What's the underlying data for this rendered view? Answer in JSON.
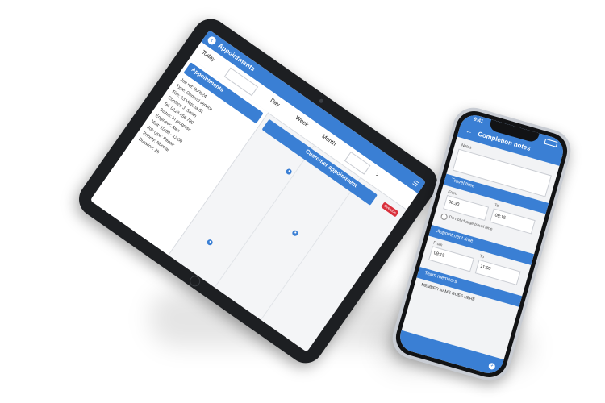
{
  "tablet": {
    "header": {
      "back_icon": "‹",
      "title": "Appointments",
      "menu_icon": "☰"
    },
    "topbar": {
      "left_label": "Today",
      "right_label": "Month",
      "week_label": "Week",
      "day_label": "Day",
      "nav_icon": "›"
    },
    "sidebar": {
      "head": "Appointments",
      "info": [
        "Job ref: 000024",
        "Type: General service",
        "Site: 13 Victoria St",
        "Contact: J. Smith",
        "Tel: 0123 456 789",
        "Status: In progress",
        "Engineer: Alex",
        "Visit: 10:00 - 12:00",
        "Job type: Repair",
        "Priority: Normal",
        "Duration: 2h"
      ]
    },
    "main": {
      "banner": "Customer appointment",
      "badge": "Overdue"
    }
  },
  "phone": {
    "time": "9:41",
    "header": {
      "back_icon": "←",
      "title": "Completion notes"
    },
    "notes_label": "Notes",
    "sections": {
      "travel": "Travel time",
      "appointment": "Appointment time",
      "team": "Team members"
    },
    "travel": {
      "from_label": "From",
      "from_value": "08:30",
      "to_label": "To",
      "to_value": "09:15",
      "checkbox_label": "Do not charge travel time"
    },
    "appointment": {
      "from_label": "From",
      "from_value": "09:15",
      "to_label": "To",
      "to_value": "11:00"
    },
    "team": {
      "member": "MEMBER NAME GOES HERE"
    },
    "fab_icon": "+"
  }
}
